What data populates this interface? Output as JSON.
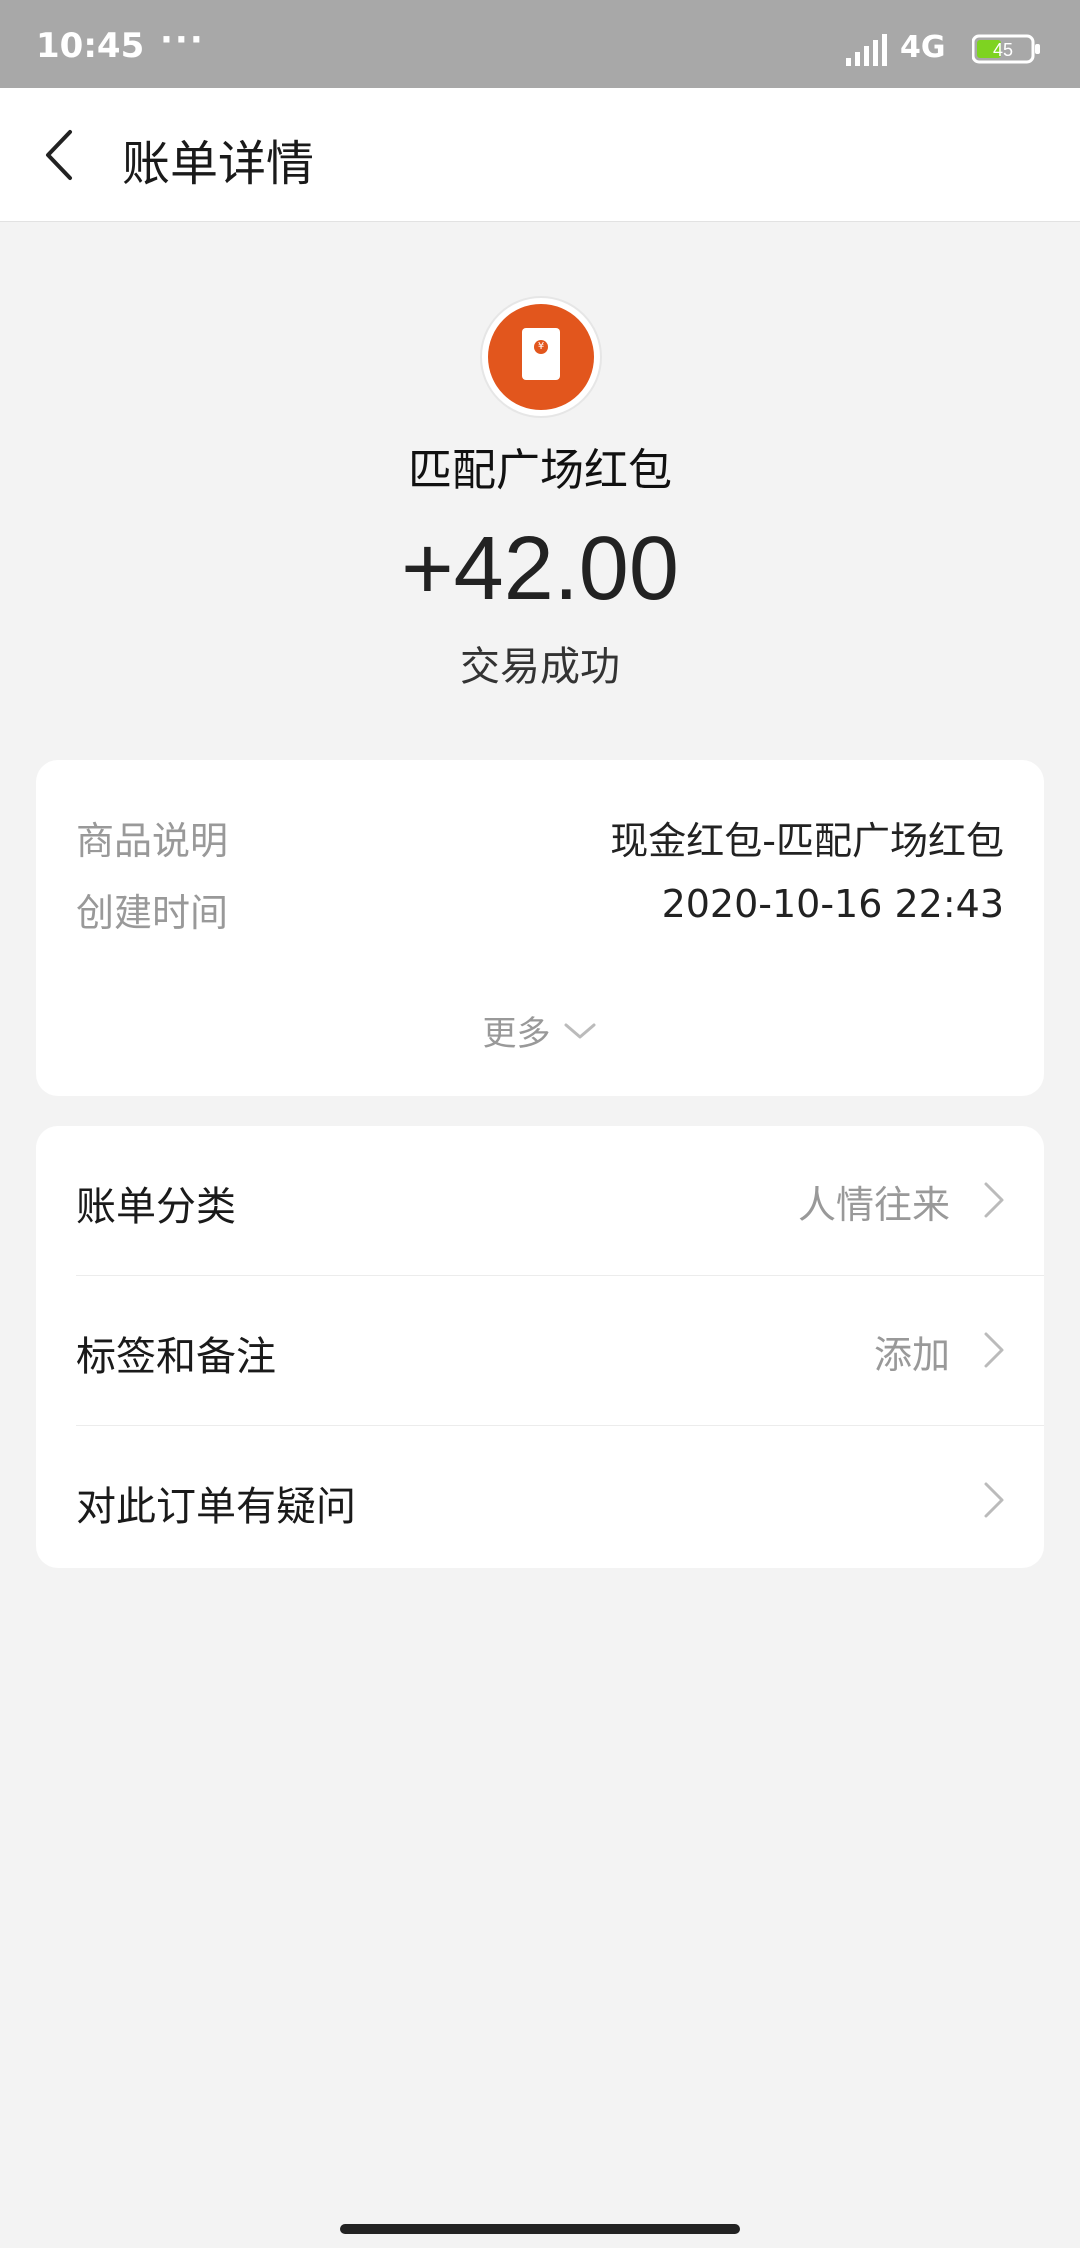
{
  "status_bar": {
    "time": "10:45",
    "dots": "···",
    "center_text": "",
    "network": "4G",
    "battery": "45"
  },
  "header": {
    "title": "账单详情",
    "back_icon": "chevron-left-icon"
  },
  "summary": {
    "merchant_name": "匹配广场红包",
    "amount": "+42.00",
    "status": "交易成功",
    "avatar_icon": "red-envelope-icon",
    "avatar_color": "#e2561d"
  },
  "details": {
    "rows": [
      {
        "label": "商品说明",
        "value": "现金红包-匹配广场红包"
      },
      {
        "label": "创建时间",
        "value": "2020-10-16 22:43"
      }
    ],
    "more_label": "更多"
  },
  "actions": {
    "rows": [
      {
        "label": "账单分类",
        "value": "人情往来"
      },
      {
        "label": "标签和备注",
        "value": "添加"
      },
      {
        "label": "对此订单有疑问",
        "value": ""
      }
    ]
  }
}
